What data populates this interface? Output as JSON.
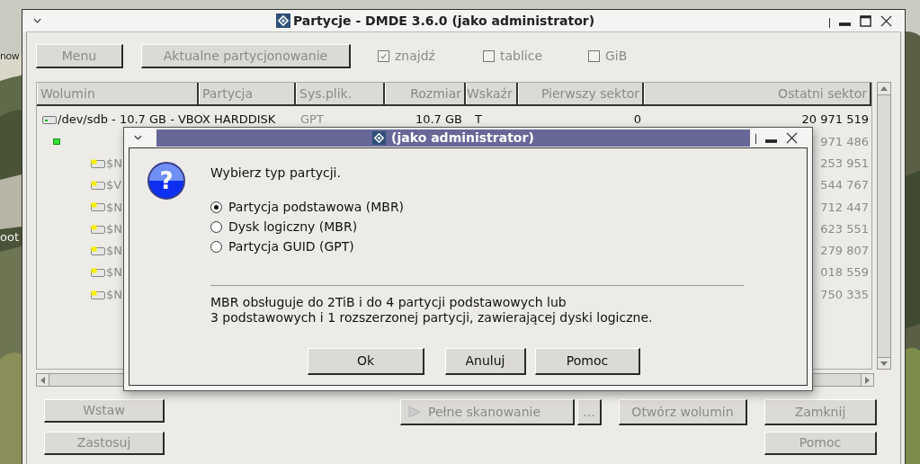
{
  "desktop": {
    "labels": [
      "now",
      "oot"
    ]
  },
  "window": {
    "title": "Partycje - DMDE 3.6.0 (jako administrator)"
  },
  "toolbar": {
    "buttons": [
      {
        "label": "Menu",
        "disabled": true
      },
      {
        "label": "Aktualne partycjonowanie",
        "disabled": true
      }
    ],
    "checkboxes": [
      {
        "label": "znajdź",
        "checked": true
      },
      {
        "label": "tablice",
        "checked": false
      },
      {
        "label": "GiB",
        "checked": false
      }
    ]
  },
  "table": {
    "columns": [
      "Wolumin",
      "Partycja",
      "Sys.plik.",
      "Rozmiar",
      "Wskaźr",
      "Pierwszy sektor",
      "Ostatni sektor"
    ],
    "rows": [
      {
        "kind": "disk",
        "dimmed": false,
        "volume": "/dev/sdb - 10.7 GB - VBOX HARDDISK",
        "fs": "GPT",
        "size": "10.7 GB",
        "flag": "T",
        "first_sector": "0",
        "last_sector": "20 971 519",
        "children": [
          {
            "kind": "partition",
            "dimmed": true,
            "last_sector": "971 486",
            "children": [
              {
                "kind": "volume",
                "dimmed": true,
                "volume": "$N",
                "last_sector": "253 951"
              },
              {
                "kind": "volume",
                "dimmed": true,
                "volume": "$V",
                "last_sector": "544 767"
              },
              {
                "kind": "volume",
                "dimmed": true,
                "volume": "$N",
                "last_sector": "712 447"
              },
              {
                "kind": "volume",
                "dimmed": true,
                "volume": "$N",
                "last_sector": "623 551"
              },
              {
                "kind": "volume",
                "dimmed": true,
                "volume": "$N",
                "last_sector": "279 807"
              },
              {
                "kind": "volume",
                "dimmed": true,
                "volume": "$N",
                "last_sector": "018 559"
              },
              {
                "kind": "volume",
                "dimmed": true,
                "volume": "$N",
                "last_sector": "750 335"
              }
            ]
          }
        ]
      }
    ]
  },
  "bottom": {
    "left": [
      {
        "label": "Wstaw",
        "disabled": true
      },
      {
        "label": "Zastosuj",
        "disabled": true
      }
    ],
    "scan": {
      "label": "Pełne skanowanie",
      "disabled": true
    },
    "more": {
      "label": "...",
      "disabled": true
    },
    "open": {
      "label": "Otwórz wolumin",
      "disabled": true
    },
    "right": [
      {
        "label": "Zamknij",
        "disabled": true
      },
      {
        "label": "Pomoc",
        "disabled": true
      }
    ]
  },
  "dialog": {
    "title": "(jako administrator)",
    "icon_glyph": "?",
    "prompt": "Wybierz typ partycji.",
    "options": [
      {
        "label": "Partycja podstawowa (MBR)",
        "selected": true
      },
      {
        "label": "Dysk logiczny (MBR)",
        "selected": false
      },
      {
        "label": "Partycja GUID (GPT)",
        "selected": false
      }
    ],
    "info": "MBR obsługuje do 2TiB i do 4 partycji podstawowych lub\n3 podstawowych i 1 rozszerzonej partycji, zawierającej dyski logiczne.",
    "buttons": [
      {
        "label": "Ok",
        "disabled": false
      },
      {
        "label": "Anuluj",
        "disabled": false
      },
      {
        "label": "Pomoc",
        "disabled": false
      }
    ]
  }
}
